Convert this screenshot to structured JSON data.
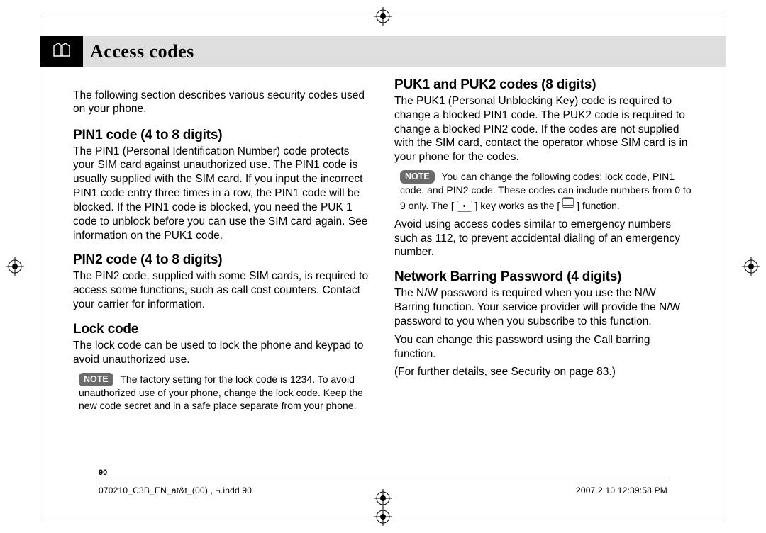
{
  "title": {
    "icon": "📄",
    "text": "Access codes"
  },
  "left": {
    "intro": "The following section describes various security codes used on your phone.",
    "h_pin1": "PIN1 code (4 to 8 digits)",
    "body_pin1": "The PIN1 (Personal Identification Number) code protects your SIM card against unauthorized use. The PIN1 code is usually supplied with the SIM card. If you input the incorrect PIN1 code entry three times in a row, the PIN1 code will be blocked. If the PIN1 code is blocked, you need the PUK 1 code to unblock before you can use the SIM card again. See information on the PUK1 code.",
    "h_pin2": "PIN2 code (4 to 8 digits)",
    "body_pin2": "The PIN2 code, supplied with some SIM cards, is required to access some functions, such as call cost counters. Contact your carrier for information.",
    "h_lock": "Lock code",
    "body_lock": "The lock code can be used to lock the phone and keypad to avoid unauthorized use.",
    "note_lock": "The factory setting for the lock code is 1234. To avoid unauthorized use of your phone, change the lock code. Keep the new code secret and in a safe place separate from your phone."
  },
  "right": {
    "h_puk": "PUK1 and PUK2 codes (8 digits)",
    "body_puk": "The PUK1 (Personal Unblocking Key) code is required to change a blocked PIN1 code. The PUK2 code is required to change a blocked PIN2 code. If the codes are not supplied with the SIM card, contact the operator whose SIM card is in your phone for the codes.",
    "note_puk_a": "You can change the following codes: lock code, PIN1 code, and PIN2 code. These codes can include numbers from 0 to 9 only. The [",
    "note_puk_b": "] key works as the [",
    "note_puk_c": "] function.",
    "body_avoid": "Avoid using access codes similar to emergency numbers such as 112, to prevent accidental dialing of an emergency number.",
    "h_net": "Network Barring Password (4 digits)",
    "body_net1": "The N/W password is required when you use the N/W Barring function. Your service provider will provide the N/W password to you when you subscribe to this function.",
    "body_net2": "You can change this password using the Call barring function.",
    "body_net3": " (For further details, see Security on page 83.)"
  },
  "labels": {
    "note": "NOTE"
  },
  "footer": {
    "page_number": "90",
    "left": "070210_C3B_EN_at&t_(00) , ¬.indd   90",
    "right": "2007.2.10   12:39:58 PM"
  }
}
